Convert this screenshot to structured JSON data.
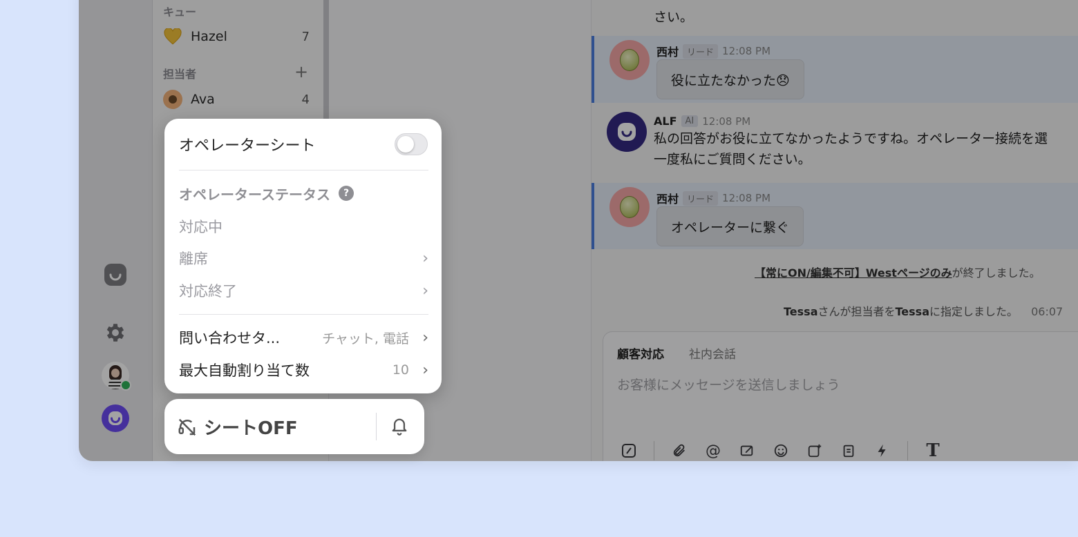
{
  "sidebar": {
    "queue_label": "キュー",
    "queue_items": [
      {
        "name": "Hazel",
        "count": "7",
        "icon": "yellow-heart"
      }
    ],
    "assignee_label": "担当者",
    "assignee_items": [
      {
        "name": "Ava",
        "count": "4"
      }
    ]
  },
  "chat": {
    "top_text": "さい。",
    "messages": [
      {
        "name": "西村",
        "tag": "リード",
        "time": "12:08 PM",
        "text": "役に立たなかった😞",
        "highlighted": true
      },
      {
        "name": "ALF",
        "tag": "AI",
        "time": "12:08 PM",
        "text": "私の回答がお役に立てなかったようですね。オペレーター接続を選",
        "text2": "一度私にご質問ください。",
        "highlighted": false
      },
      {
        "name": "西村",
        "tag": "リード",
        "time": "12:08 PM",
        "text": "オペレーターに繋ぐ",
        "highlighted": true
      }
    ],
    "system_1_link": "【常にON/編集不可】Westページのみ",
    "system_1_rest": "が終了しました。",
    "system_2_a": "Tessa",
    "system_2_b": "さんが担当者を",
    "system_2_c": "Tessa",
    "system_2_d": "に指定しました。",
    "system_2_time": "06:07"
  },
  "composer": {
    "tab_customer": "顧客対応",
    "tab_internal": "社内会話",
    "placeholder": "お客様にメッセージを送信しましょう"
  },
  "popup": {
    "operator_seat": "オペレーターシート",
    "operator_seat_on": false,
    "status_header": "オペレーターステータス",
    "status_help": "?",
    "status_active": "対応中",
    "status_away": "離席",
    "status_done": "対応終了",
    "inquiry_type_label": "問い合わせタ...",
    "inquiry_type_value": "チャット, 電話",
    "max_assign_label": "最大自動割り当て数",
    "max_assign_value": "10"
  },
  "seatbar": {
    "label": "シートOFF"
  },
  "colors": {
    "background": "#d8e4fc",
    "accent_purple": "#6c4cf5",
    "online_green": "#2fb35a",
    "highlight_bar": "#4a7de0"
  }
}
